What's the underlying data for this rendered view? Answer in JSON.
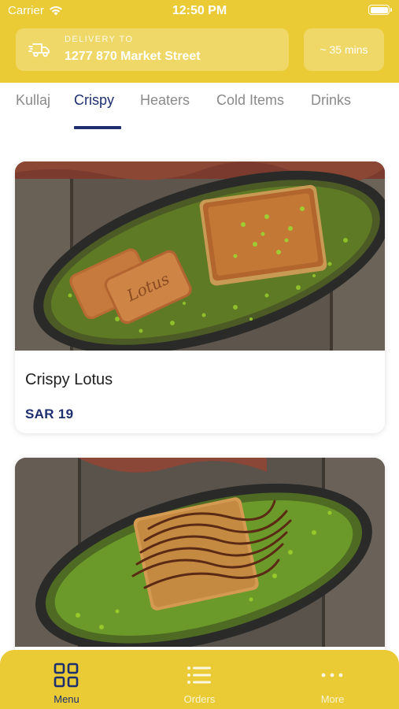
{
  "status_bar": {
    "carrier": "Carrier",
    "time": "12:50 PM",
    "wifi_icon": "wifi-icon",
    "battery_icon": "battery-icon"
  },
  "header": {
    "delivery_icon": "delivery-truck-icon",
    "delivery_label": "DELIVERY TO",
    "delivery_address": "1277 870 Market Street",
    "eta": "~ 35 mins"
  },
  "tabs": [
    {
      "label": "Kullaj",
      "active": false
    },
    {
      "label": "Crispy",
      "active": true
    },
    {
      "label": "Heaters",
      "active": false
    },
    {
      "label": "Cold Items",
      "active": false
    },
    {
      "label": "Drinks",
      "active": false
    }
  ],
  "products": [
    {
      "name": "Crispy Lotus",
      "price": "SAR 19",
      "image": "crispy-lotus-photo"
    },
    {
      "name": "",
      "price": "",
      "image": "crispy-chocolate-photo"
    }
  ],
  "bottom_nav": [
    {
      "label": "Menu",
      "icon": "grid-icon",
      "active": true
    },
    {
      "label": "Orders",
      "icon": "list-icon",
      "active": false
    },
    {
      "label": "More",
      "icon": "more-dots-icon",
      "active": false
    }
  ],
  "colors": {
    "brand_yellow": "#eacb36",
    "accent_navy": "#1d2f6f",
    "pistachio_green": "#8fbf2a"
  }
}
